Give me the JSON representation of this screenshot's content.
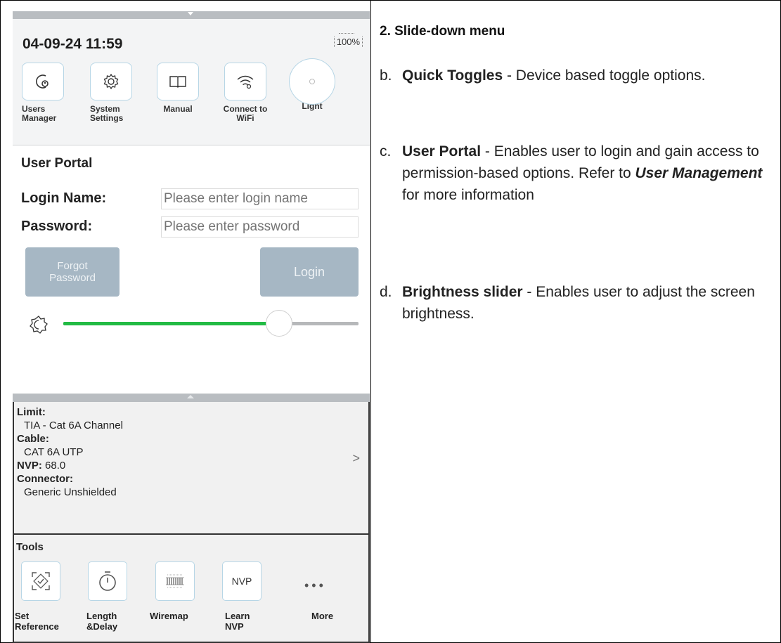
{
  "device": {
    "status": {
      "datetime": "04-09-24 11:59",
      "battery": "100%"
    },
    "quick_toggles": [
      {
        "label": "Users Manager",
        "icon": "users-manager-icon"
      },
      {
        "label": "System Settings",
        "icon": "gear-icon"
      },
      {
        "label": "Manual",
        "icon": "book-icon"
      },
      {
        "label": "Connect to WiFi",
        "icon": "wifi-icon"
      },
      {
        "label": "Light",
        "icon": "light-icon"
      }
    ],
    "user_portal": {
      "title": "User Portal",
      "login_name_label": "Login Name:",
      "login_name_placeholder": "Please enter login name",
      "password_label": "Password:",
      "password_placeholder": "Please enter password",
      "forgot_line1": "Forgot",
      "forgot_line2": "Password",
      "login_label": "Login"
    },
    "brightness": {
      "level": 0.73,
      "icon": "brightness-icon",
      "fill_color": "#22bb44"
    },
    "settings": {
      "limit_label": "Limit:",
      "limit_value": "TIA - Cat 6A Channel",
      "cable_label": "Cable:",
      "cable_value": "CAT 6A UTP",
      "nvp_label": "NVP:",
      "nvp_value": "68.0",
      "connector_label": "Connector:",
      "connector_value": "Generic Unshielded",
      "chevron": ">"
    },
    "tools": {
      "title": "Tools",
      "items": [
        {
          "line1": "Set",
          "line2": "Reference",
          "icon": "set-reference-icon"
        },
        {
          "line1": "Length",
          "line2": "&Delay",
          "icon": "stopwatch-icon"
        },
        {
          "line1": "Wiremap",
          "line2": "",
          "icon": "wiremap-icon"
        },
        {
          "line1": "Learn",
          "line2": "NVP",
          "icon": "nvp-icon",
          "box_text": "NVP"
        },
        {
          "line1": "More",
          "line2": "",
          "icon": "more-icon"
        }
      ]
    }
  },
  "description": {
    "title": "2. Slide-down menu",
    "items": [
      {
        "letter": "b.",
        "term": "Quick Toggles",
        "text": " - Device based toggle options."
      },
      {
        "letter": "c.",
        "term": "User Portal",
        "text": " - Enables user to login and gain access to permission-based options. Refer to ",
        "emph": "User Management",
        "text2": " for more information"
      },
      {
        "letter": "d.",
        "term": "Brightness slider",
        "text": " - Enables user to adjust the screen brightness."
      }
    ]
  }
}
